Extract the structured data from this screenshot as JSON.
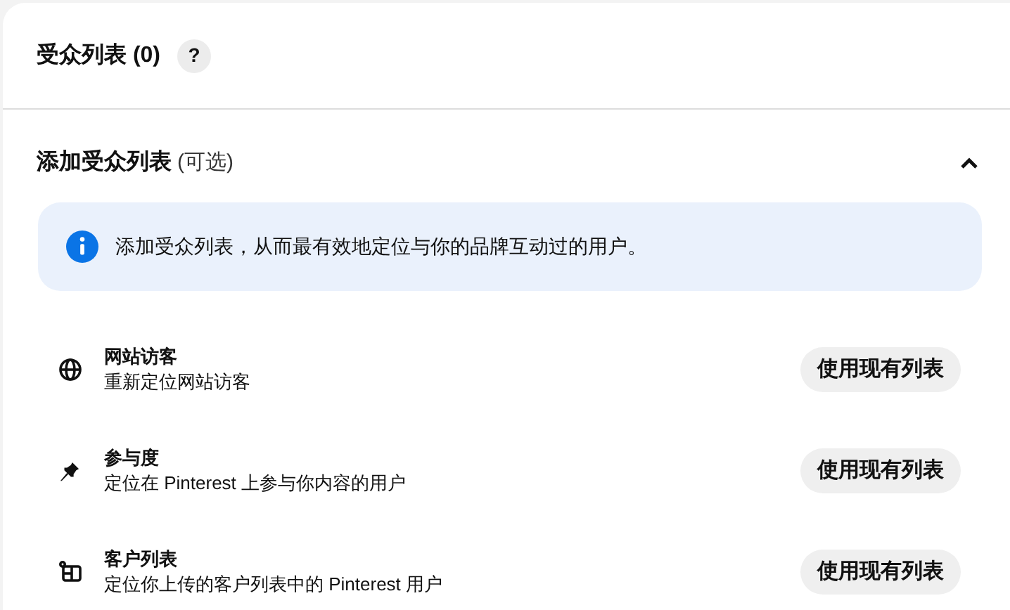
{
  "header": {
    "title": "受众列表 (0)",
    "help": "?"
  },
  "section": {
    "title": "添加受众列表",
    "optional": "(可选)",
    "expanded": true,
    "info": "添加受众列表，从而最有效地定位与你的品牌互动过的用户。",
    "items": [
      {
        "kind": "globe",
        "title": "网站访客",
        "description": "重新定位网站访客",
        "button": "使用现有列表"
      },
      {
        "kind": "pin",
        "title": "参与度",
        "description": "定位在 Pinterest 上参与你内容的用户",
        "button": "使用现有列表"
      },
      {
        "kind": "list",
        "title": "客户列表",
        "description": "定位你上传的客户列表中的 Pinterest 用户",
        "button": "使用现有列表"
      }
    ]
  }
}
